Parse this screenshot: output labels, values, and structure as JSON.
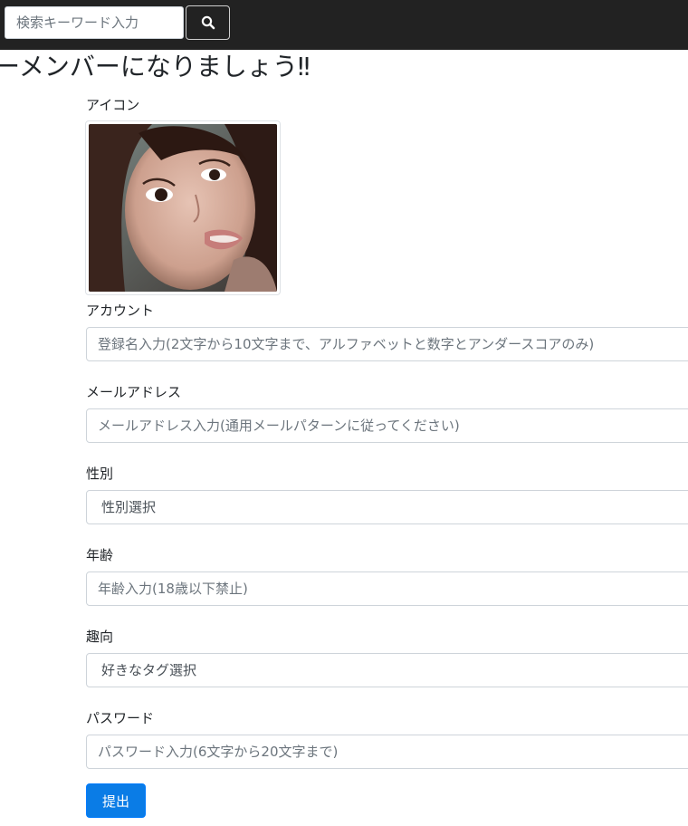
{
  "navbar": {
    "search": {
      "placeholder": "検索キーワード入力",
      "button_icon": "search-icon"
    }
  },
  "page": {
    "title": "のーメンバーになりましょう‼"
  },
  "form": {
    "avatar_label": "アイコン",
    "account": {
      "label": "アカウント",
      "placeholder": "登録名入力(2文字から10文字まで、アルファベットと数字とアンダースコアのみ)"
    },
    "email": {
      "label": "メールアドレス",
      "placeholder": "メールアドレス入力(通用メールパターンに従ってください)"
    },
    "gender": {
      "label": "性別",
      "selected": "性別選択"
    },
    "age": {
      "label": "年齢",
      "placeholder": "年齢入力(18歳以下禁止)"
    },
    "interest": {
      "label": "趣向",
      "selected": "好きなタグ選択"
    },
    "password": {
      "label": "パスワード",
      "placeholder": "パスワード入力(6文字から20文字まで)"
    },
    "submit_label": "提出"
  },
  "colors": {
    "navbar_bg": "#222222",
    "primary": "#0a7ce6"
  }
}
